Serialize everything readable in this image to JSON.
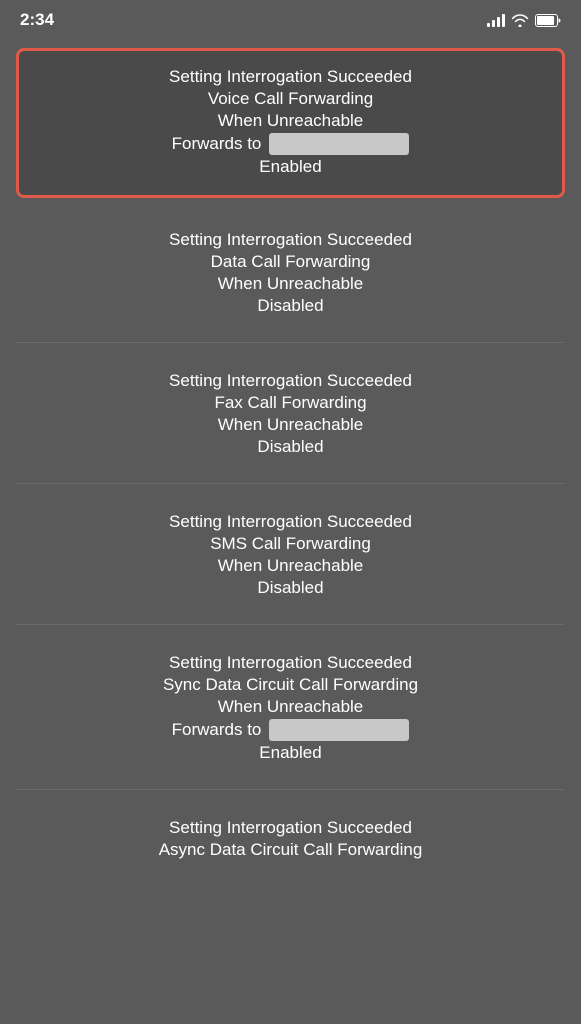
{
  "statusBar": {
    "time": "2:34",
    "signal": "signal",
    "wifi": "wifi",
    "battery": "battery"
  },
  "cards": [
    {
      "id": "voice-call-forwarding",
      "highlighted": true,
      "title": "Setting Interrogation Succeeded",
      "subtitle": "Voice Call Forwarding",
      "detail": "When Unreachable",
      "forwardsTo": true,
      "forwardsLabel": "Forwards to",
      "status": "Enabled"
    },
    {
      "id": "data-call-forwarding",
      "highlighted": false,
      "title": "Setting Interrogation Succeeded",
      "subtitle": "Data Call Forwarding",
      "detail": "When Unreachable",
      "forwardsTo": false,
      "status": "Disabled"
    },
    {
      "id": "fax-call-forwarding",
      "highlighted": false,
      "title": "Setting Interrogation Succeeded",
      "subtitle": "Fax Call Forwarding",
      "detail": "When Unreachable",
      "forwardsTo": false,
      "status": "Disabled"
    },
    {
      "id": "sms-call-forwarding",
      "highlighted": false,
      "title": "Setting Interrogation Succeeded",
      "subtitle": "SMS Call Forwarding",
      "detail": "When Unreachable",
      "forwardsTo": false,
      "status": "Disabled"
    },
    {
      "id": "sync-data-circuit-call-forwarding",
      "highlighted": false,
      "title": "Setting Interrogation Succeeded",
      "subtitle": "Sync Data Circuit Call Forwarding",
      "detail": "When Unreachable",
      "forwardsTo": true,
      "forwardsLabel": "Forwards to",
      "status": "Enabled"
    },
    {
      "id": "async-data-circuit-call-forwarding",
      "highlighted": false,
      "title": "Setting Interrogation Succeeded",
      "subtitle": "Async Data Circuit Call Forwarding",
      "detail": null,
      "forwardsTo": false,
      "status": null,
      "partial": true
    }
  ]
}
